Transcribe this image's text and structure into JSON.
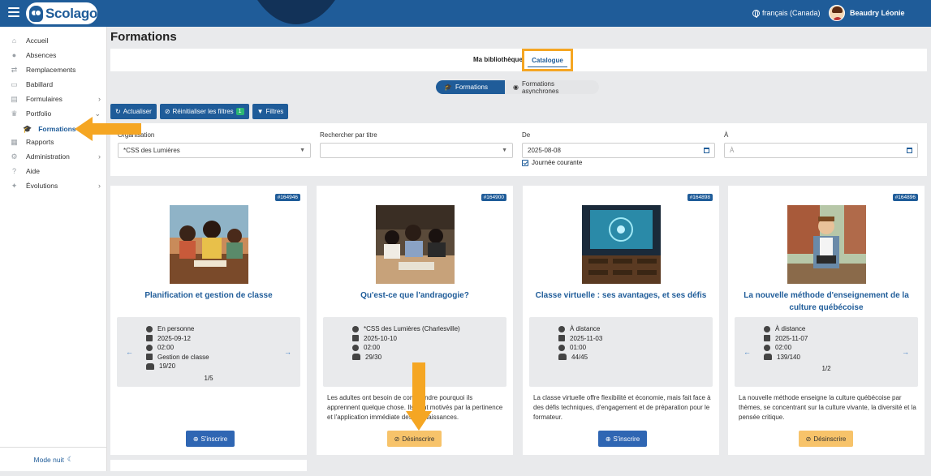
{
  "header": {
    "app_name": "Scolago",
    "language": "français (Canada)",
    "user_name": "Beaudry Léonie"
  },
  "sidebar": {
    "items": [
      {
        "label": "Accueil",
        "icon": "home-icon"
      },
      {
        "label": "Absences",
        "icon": "absences-icon"
      },
      {
        "label": "Remplacements",
        "icon": "remplacements-icon"
      },
      {
        "label": "Babillard",
        "icon": "babillard-icon"
      },
      {
        "label": "Formulaires",
        "icon": "formulaires-icon",
        "chevron": "›"
      },
      {
        "label": "Portfolio",
        "icon": "trophy-icon",
        "chevron": "⌄"
      },
      {
        "label": "Rapports",
        "icon": "rapports-icon"
      },
      {
        "label": "Administration",
        "icon": "gear-icon",
        "chevron": "›"
      },
      {
        "label": "Aide",
        "icon": "help-icon"
      },
      {
        "label": "Évolutions",
        "icon": "evolutions-icon",
        "chevron": "›"
      }
    ],
    "sub_item": {
      "label": "Formations",
      "icon": "graduation-cap-icon"
    },
    "mode_nuit": "Mode nuit"
  },
  "page": {
    "title": "Formations",
    "tabs": {
      "bibliotheque": "Ma bibliothèque",
      "catalogue": "Catalogue"
    },
    "toggle": {
      "formations": "Formations",
      "asynchrones": "Formations asynchrones"
    },
    "toolbar": {
      "actualiser": "Actualiser",
      "reinitialiser": "Réinitialiser les filtres",
      "reinitialiser_count": "1",
      "filtres": "Filtres"
    }
  },
  "filters": {
    "organisation_label": "Organisation",
    "organisation_value": "*CSS des Lumières",
    "titre_label": "Rechercher par titre",
    "titre_value": "",
    "de_label": "De",
    "de_value": "2025-08-08",
    "a_label": "À",
    "a_placeholder": "À",
    "journee_courante": "Journée courante"
  },
  "cards": [
    {
      "id": "#164946",
      "title": "Planification et gestion de classe",
      "lines": [
        "En personne",
        "2025-09-12",
        "02:00",
        "Gestion de classe",
        "19/20"
      ],
      "pager": "1/5",
      "description": "",
      "action": "S'inscrire"
    },
    {
      "id": "#164900",
      "title": "Qu'est-ce que l'andragogie?",
      "lines": [
        "*CSS des Lumières (Charlesville)",
        "2025-10-10",
        "02:00",
        "29/30"
      ],
      "pager": "",
      "description": "Les adultes ont besoin de comprendre pourquoi ils apprennent quelque chose. Ils sont motivés par la pertinence et l'application immédiate des connaissances.",
      "action": "Désinscrire"
    },
    {
      "id": "#164898",
      "title": "Classe virtuelle : ses avantages, et ses défis",
      "lines": [
        "À distance",
        "2025-11-03",
        "01:00",
        "44/45"
      ],
      "pager": "",
      "description": "La classe virtuelle offre flexibilité et économie, mais fait face à des défis techniques, d'engagement et de préparation pour le formateur.",
      "action": "S'inscrire"
    },
    {
      "id": "#164896",
      "title": "La nouvelle méthode d'enseignement de la culture québécoise",
      "lines": [
        "À distance",
        "2025-11-07",
        "02:00",
        "139/140"
      ],
      "pager": "1/2",
      "description": "La nouvelle méthode enseigne la culture québécoise par thèmes, se concentrant sur la culture vivante, la diversité et la pensée critique.",
      "action": "Désinscrire"
    }
  ],
  "colors": {
    "primary": "#1f5c99",
    "accent_orange": "#f5a623",
    "unsubscribe": "#f7c36a",
    "success": "#2bb673"
  }
}
